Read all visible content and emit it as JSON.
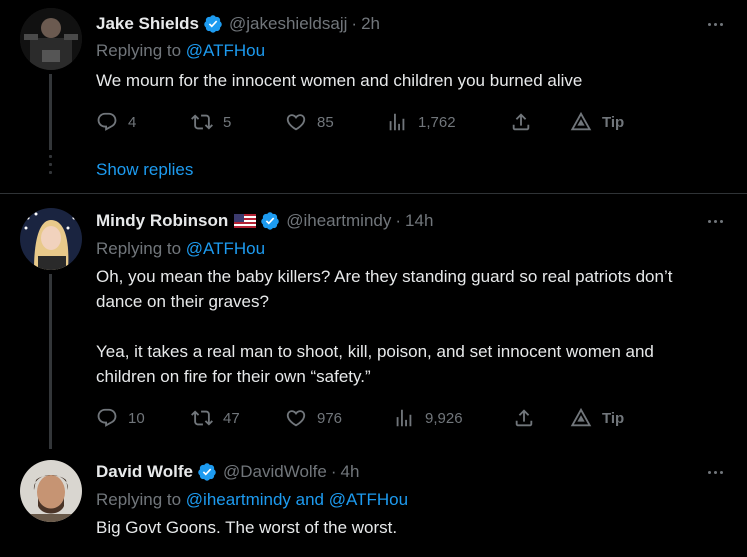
{
  "tweets": [
    {
      "name": "Jake Shields",
      "handle": "@jakeshieldsajj",
      "time": "2h",
      "reply_prefix": "Replying to ",
      "reply_to": "@ATFHou",
      "text": [
        "We mourn for the innocent women and children you burned alive"
      ],
      "stats": {
        "replies": "4",
        "retweets": "5",
        "likes": "85",
        "views": "1,762",
        "tip": "Tip"
      }
    },
    {
      "name": "Mindy Robinson",
      "handle": "@iheartmindy",
      "time": "14h",
      "reply_prefix": "Replying to ",
      "reply_to": "@ATFHou",
      "text": [
        "Oh, you mean the baby killers? Are they standing guard so real patriots don’t dance on their graves?",
        "Yea, it takes a real man to shoot, kill, poison, and set innocent women and children on fire for their own “safety.”"
      ],
      "stats": {
        "replies": "10",
        "retweets": "47",
        "likes": "976",
        "views": "9,926",
        "tip": "Tip"
      }
    },
    {
      "name": "David Wolfe",
      "handle": "@DavidWolfe",
      "time": "4h",
      "reply_prefix": "Replying to ",
      "reply_to_1": "@iheartmindy",
      "reply_and": " and ",
      "reply_to_2": "@ATFHou",
      "text": [
        "Big Govt Goons. The worst of the worst."
      ]
    }
  ],
  "show_replies": "Show replies",
  "sep": "·",
  "colors": {
    "accent": "#1d9bf0",
    "muted": "#71767b",
    "text": "#e7e9ea",
    "background": "#000000"
  },
  "icons": [
    "verified-badge-icon",
    "us-flag-icon",
    "more-icon",
    "reply-icon",
    "retweet-icon",
    "like-icon",
    "views-icon",
    "share-icon",
    "tip-icon"
  ]
}
